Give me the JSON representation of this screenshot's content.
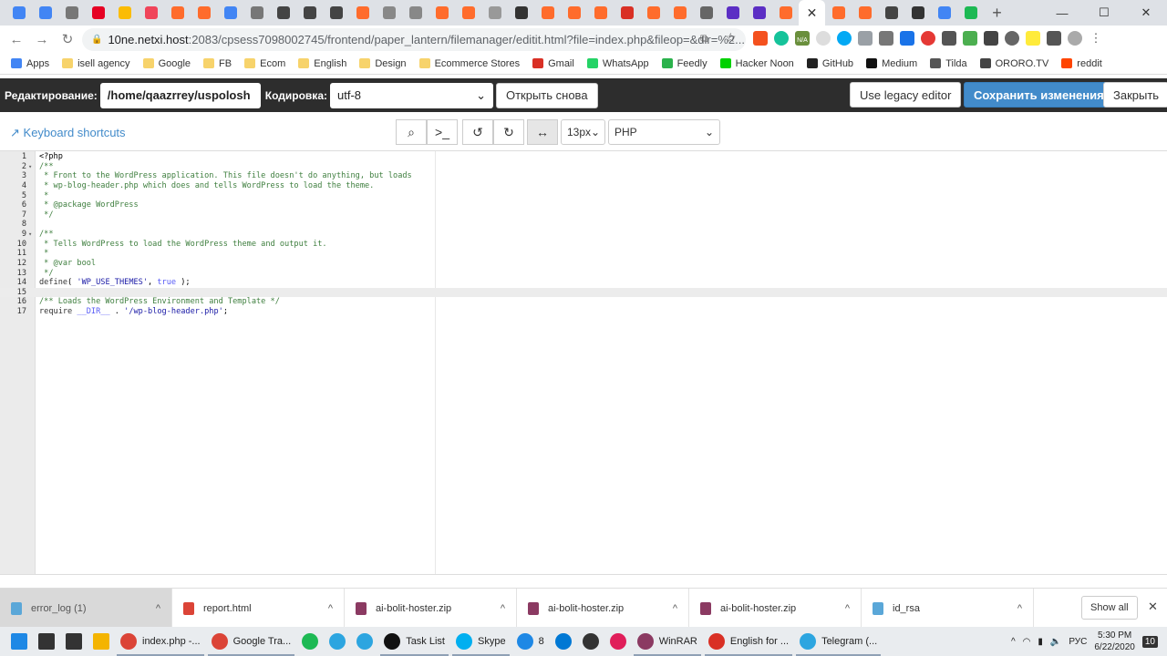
{
  "browser": {
    "tabs": [
      {
        "icon": "chrome-icon",
        "color": "#4285f4"
      },
      {
        "icon": "chrome-icon",
        "color": "#4285f4"
      },
      {
        "icon": "wordpress-icon",
        "color": "#777"
      },
      {
        "icon": "pinterest-icon",
        "color": "#e60023"
      },
      {
        "icon": "chrome-color-icon",
        "color": "#fbbc05"
      },
      {
        "icon": "red-square-icon",
        "color": "#f0445a"
      },
      {
        "icon": "cpanel-icon",
        "color": "#ff6c2c"
      },
      {
        "icon": "cpanel-icon",
        "color": "#ff6c2c"
      },
      {
        "icon": "translate-icon",
        "color": "#4285f4"
      },
      {
        "icon": "wordpress-icon",
        "color": "#777"
      },
      {
        "icon": "bug-icon",
        "color": "#444"
      },
      {
        "icon": "bug-icon",
        "color": "#444"
      },
      {
        "icon": "link-icon",
        "color": "#444"
      },
      {
        "icon": "cpanel-icon",
        "color": "#ff6c2c"
      },
      {
        "icon": "chart-icon",
        "color": "#888"
      },
      {
        "icon": "chart-icon",
        "color": "#888"
      },
      {
        "icon": "cpanel-icon",
        "color": "#ff6c2c"
      },
      {
        "icon": "cpanel-icon",
        "color": "#ff6c2c"
      },
      {
        "icon": "globe-icon",
        "color": "#999"
      },
      {
        "icon": "amazon-icon",
        "color": "#333"
      },
      {
        "icon": "cpanel-icon",
        "color": "#ff6c2c"
      },
      {
        "icon": "cpanel-icon",
        "color": "#ff6c2c"
      },
      {
        "icon": "cpanel-icon",
        "color": "#ff6c2c"
      },
      {
        "icon": "gmail-icon",
        "color": "#d93025"
      },
      {
        "icon": "cpanel-icon",
        "color": "#ff6c2c"
      },
      {
        "icon": "cpanel-icon",
        "color": "#ff6c2c"
      },
      {
        "icon": "globe-icon",
        "color": "#666"
      },
      {
        "icon": "k-icon",
        "color": "#5b2ec4"
      },
      {
        "icon": "k-icon",
        "color": "#5b2ec4"
      },
      {
        "icon": "cpanel-icon",
        "color": "#ff6c2c"
      }
    ],
    "active_tab_close": "✕",
    "tabs_after": [
      {
        "icon": "cpanel-icon",
        "color": "#ff6c2c"
      },
      {
        "icon": "cpanel-icon",
        "color": "#ff6c2c"
      },
      {
        "icon": "bug-icon",
        "color": "#444"
      },
      {
        "icon": "book-icon",
        "color": "#333"
      },
      {
        "icon": "google-icon",
        "color": "#4285f4"
      },
      {
        "icon": "spotify-icon",
        "color": "#1db954"
      }
    ],
    "new_tab": "+",
    "url_host": "10ne.netxi.host",
    "url_rest": ":2083/cpsess7098002745/frontend/paper_lantern/filemanager/editit.html?file=index.php&fileop=&dir=%2...",
    "extension_na": "N/A",
    "bookmarks": [
      {
        "label": "Apps",
        "color": "#4285f4"
      },
      {
        "label": "isell agency",
        "color": "#f7d36b"
      },
      {
        "label": "Google",
        "color": "#f7d36b"
      },
      {
        "label": "FB",
        "color": "#f7d36b"
      },
      {
        "label": "Ecom",
        "color": "#f7d36b"
      },
      {
        "label": "English",
        "color": "#f7d36b"
      },
      {
        "label": "Design",
        "color": "#f7d36b"
      },
      {
        "label": "Ecommerce Stores",
        "color": "#f7d36b"
      },
      {
        "label": "Gmail",
        "color": "#d93025"
      },
      {
        "label": "WhatsApp",
        "color": "#25d366"
      },
      {
        "label": "Feedly",
        "color": "#2bb24c"
      },
      {
        "label": "Hacker Noon",
        "color": "#00d100"
      },
      {
        "label": "GitHub",
        "color": "#222"
      },
      {
        "label": "Medium",
        "color": "#111"
      },
      {
        "label": "Tilda",
        "color": "#555"
      },
      {
        "label": "ORORO.TV",
        "color": "#444"
      },
      {
        "label": "reddit",
        "color": "#ff4500"
      }
    ]
  },
  "header": {
    "editing_label": "Редактирование:",
    "path": "/home/qaazrrey/uspolosh",
    "encoding_label": "Кодировка:",
    "encoding": "utf-8",
    "reopen": "Открыть снова",
    "legacy": "Use legacy editor",
    "save": "Сохранить изменения",
    "close": "Закрыть"
  },
  "toolbar": {
    "shortcuts": "Keyboard shortcuts",
    "font_size": "13px",
    "mode": "PHP"
  },
  "editor": {
    "current_line": 15,
    "lines": [
      {
        "n": "1",
        "html": "&lt;?php"
      },
      {
        "n": "2",
        "fold": true,
        "html": "<span class='c'>/**</span>"
      },
      {
        "n": "3",
        "html": "<span class='c'> * Front to the WordPress application. This file doesn't do anything, but loads</span>"
      },
      {
        "n": "4",
        "html": "<span class='c'> * wp-blog-header.php which does and tells WordPress to load the theme.</span>"
      },
      {
        "n": "5",
        "html": "<span class='c'> *</span>"
      },
      {
        "n": "6",
        "html": "<span class='c'> * @package WordPress</span>"
      },
      {
        "n": "7",
        "html": "<span class='c'> */</span>"
      },
      {
        "n": "8",
        "html": ""
      },
      {
        "n": "9",
        "fold": true,
        "html": "<span class='c'>/**</span>"
      },
      {
        "n": "10",
        "html": "<span class='c'> * Tells WordPress to load the WordPress theme and output it.</span>"
      },
      {
        "n": "11",
        "html": "<span class='c'> *</span>"
      },
      {
        "n": "12",
        "html": "<span class='c'> * @var bool</span>"
      },
      {
        "n": "13",
        "html": "<span class='c'> */</span>"
      },
      {
        "n": "14",
        "html": "<span class='fn'>define</span>( <span class='s'>'WP_USE_THEMES'</span>, <span class='k'>true</span> );"
      },
      {
        "n": "15",
        "html": ""
      },
      {
        "n": "16",
        "html": "<span class='c'>/** Loads the WordPress Environment and Template */</span>"
      },
      {
        "n": "17",
        "html": "<span class='fn'>require</span> <span class='k'>__DIR__</span> . <span class='s'>'/wp-blog-header.php'</span>;"
      }
    ]
  },
  "downloads": {
    "items": [
      {
        "name": "error_log (1)",
        "color": "#5aa7d8"
      },
      {
        "name": "report.html",
        "color": "#db4437"
      },
      {
        "name": "ai-bolit-hoster.zip",
        "color": "#8b3a62"
      },
      {
        "name": "ai-bolit-hoster.zip",
        "color": "#8b3a62"
      },
      {
        "name": "ai-bolit-hoster.zip",
        "color": "#8b3a62"
      },
      {
        "name": "id_rsa",
        "color": "#5aa7d8"
      }
    ],
    "show_all": "Show all",
    "close": "✕"
  },
  "taskbar": {
    "items": [
      {
        "label": "",
        "color": "#1e88e5",
        "name": "start"
      },
      {
        "label": "",
        "color": "#333",
        "name": "search"
      },
      {
        "label": "",
        "color": "#333",
        "name": "task-view"
      },
      {
        "label": "",
        "color": "#f4b400",
        "name": "file-explorer"
      },
      {
        "label": "index.php -...",
        "color": "#db4437",
        "open": true,
        "name": "chrome"
      },
      {
        "label": "Google Tra...",
        "color": "#db4437",
        "open": true,
        "name": "chrome"
      },
      {
        "label": "",
        "color": "#1db954",
        "name": "spotify"
      },
      {
        "label": "",
        "color": "#2ca5e0",
        "name": "telegram"
      },
      {
        "label": "",
        "color": "#2ca5e0",
        "name": "telegram"
      },
      {
        "label": "Task List",
        "color": "#111",
        "open": true,
        "name": "notion"
      },
      {
        "label": "Skype",
        "color": "#00aff0",
        "open": true,
        "name": "skype"
      },
      {
        "label": "8",
        "color": "#1e88e5",
        "name": "mail"
      },
      {
        "label": "",
        "color": "#0078d4",
        "name": "vscode"
      },
      {
        "label": "",
        "color": "#333",
        "name": "notes"
      },
      {
        "label": "",
        "color": "#e01e5a",
        "name": "slack"
      },
      {
        "label": "WinRAR",
        "color": "#8b3a62",
        "open": true,
        "name": "winrar"
      },
      {
        "label": "English for ...",
        "color": "#d93025",
        "open": true,
        "name": "pdf"
      },
      {
        "label": "Telegram (...",
        "color": "#2ca5e0",
        "open": true,
        "name": "telegram"
      }
    ],
    "lang": "РУС",
    "time": "5:30 PM",
    "date": "6/22/2020",
    "notifications": "10"
  }
}
